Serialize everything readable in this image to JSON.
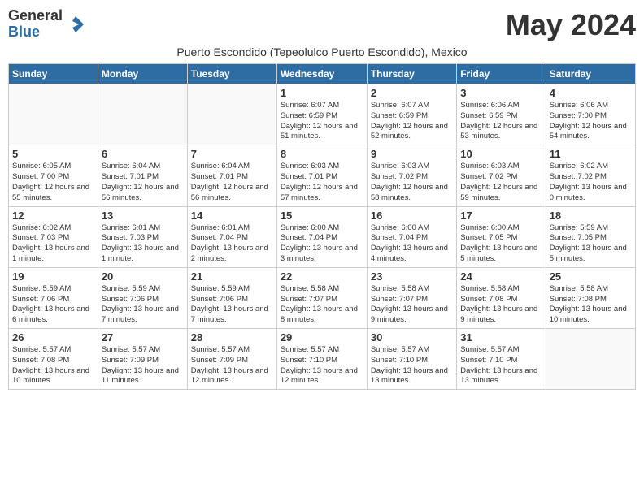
{
  "logo": {
    "general": "General",
    "blue": "Blue"
  },
  "title": "May 2024",
  "subtitle": "Puerto Escondido (Tepeolulco Puerto Escondido), Mexico",
  "weekdays": [
    "Sunday",
    "Monday",
    "Tuesday",
    "Wednesday",
    "Thursday",
    "Friday",
    "Saturday"
  ],
  "weeks": [
    [
      {
        "day": "",
        "info": ""
      },
      {
        "day": "",
        "info": ""
      },
      {
        "day": "",
        "info": ""
      },
      {
        "day": "1",
        "info": "Sunrise: 6:07 AM\nSunset: 6:59 PM\nDaylight: 12 hours and 51 minutes."
      },
      {
        "day": "2",
        "info": "Sunrise: 6:07 AM\nSunset: 6:59 PM\nDaylight: 12 hours and 52 minutes."
      },
      {
        "day": "3",
        "info": "Sunrise: 6:06 AM\nSunset: 6:59 PM\nDaylight: 12 hours and 53 minutes."
      },
      {
        "day": "4",
        "info": "Sunrise: 6:06 AM\nSunset: 7:00 PM\nDaylight: 12 hours and 54 minutes."
      }
    ],
    [
      {
        "day": "5",
        "info": "Sunrise: 6:05 AM\nSunset: 7:00 PM\nDaylight: 12 hours and 55 minutes."
      },
      {
        "day": "6",
        "info": "Sunrise: 6:04 AM\nSunset: 7:01 PM\nDaylight: 12 hours and 56 minutes."
      },
      {
        "day": "7",
        "info": "Sunrise: 6:04 AM\nSunset: 7:01 PM\nDaylight: 12 hours and 56 minutes."
      },
      {
        "day": "8",
        "info": "Sunrise: 6:03 AM\nSunset: 7:01 PM\nDaylight: 12 hours and 57 minutes."
      },
      {
        "day": "9",
        "info": "Sunrise: 6:03 AM\nSunset: 7:02 PM\nDaylight: 12 hours and 58 minutes."
      },
      {
        "day": "10",
        "info": "Sunrise: 6:03 AM\nSunset: 7:02 PM\nDaylight: 12 hours and 59 minutes."
      },
      {
        "day": "11",
        "info": "Sunrise: 6:02 AM\nSunset: 7:02 PM\nDaylight: 13 hours and 0 minutes."
      }
    ],
    [
      {
        "day": "12",
        "info": "Sunrise: 6:02 AM\nSunset: 7:03 PM\nDaylight: 13 hours and 1 minute."
      },
      {
        "day": "13",
        "info": "Sunrise: 6:01 AM\nSunset: 7:03 PM\nDaylight: 13 hours and 1 minute."
      },
      {
        "day": "14",
        "info": "Sunrise: 6:01 AM\nSunset: 7:04 PM\nDaylight: 13 hours and 2 minutes."
      },
      {
        "day": "15",
        "info": "Sunrise: 6:00 AM\nSunset: 7:04 PM\nDaylight: 13 hours and 3 minutes."
      },
      {
        "day": "16",
        "info": "Sunrise: 6:00 AM\nSunset: 7:04 PM\nDaylight: 13 hours and 4 minutes."
      },
      {
        "day": "17",
        "info": "Sunrise: 6:00 AM\nSunset: 7:05 PM\nDaylight: 13 hours and 5 minutes."
      },
      {
        "day": "18",
        "info": "Sunrise: 5:59 AM\nSunset: 7:05 PM\nDaylight: 13 hours and 5 minutes."
      }
    ],
    [
      {
        "day": "19",
        "info": "Sunrise: 5:59 AM\nSunset: 7:06 PM\nDaylight: 13 hours and 6 minutes."
      },
      {
        "day": "20",
        "info": "Sunrise: 5:59 AM\nSunset: 7:06 PM\nDaylight: 13 hours and 7 minutes."
      },
      {
        "day": "21",
        "info": "Sunrise: 5:59 AM\nSunset: 7:06 PM\nDaylight: 13 hours and 7 minutes."
      },
      {
        "day": "22",
        "info": "Sunrise: 5:58 AM\nSunset: 7:07 PM\nDaylight: 13 hours and 8 minutes."
      },
      {
        "day": "23",
        "info": "Sunrise: 5:58 AM\nSunset: 7:07 PM\nDaylight: 13 hours and 9 minutes."
      },
      {
        "day": "24",
        "info": "Sunrise: 5:58 AM\nSunset: 7:08 PM\nDaylight: 13 hours and 9 minutes."
      },
      {
        "day": "25",
        "info": "Sunrise: 5:58 AM\nSunset: 7:08 PM\nDaylight: 13 hours and 10 minutes."
      }
    ],
    [
      {
        "day": "26",
        "info": "Sunrise: 5:57 AM\nSunset: 7:08 PM\nDaylight: 13 hours and 10 minutes."
      },
      {
        "day": "27",
        "info": "Sunrise: 5:57 AM\nSunset: 7:09 PM\nDaylight: 13 hours and 11 minutes."
      },
      {
        "day": "28",
        "info": "Sunrise: 5:57 AM\nSunset: 7:09 PM\nDaylight: 13 hours and 12 minutes."
      },
      {
        "day": "29",
        "info": "Sunrise: 5:57 AM\nSunset: 7:10 PM\nDaylight: 13 hours and 12 minutes."
      },
      {
        "day": "30",
        "info": "Sunrise: 5:57 AM\nSunset: 7:10 PM\nDaylight: 13 hours and 13 minutes."
      },
      {
        "day": "31",
        "info": "Sunrise: 5:57 AM\nSunset: 7:10 PM\nDaylight: 13 hours and 13 minutes."
      },
      {
        "day": "",
        "info": ""
      }
    ]
  ]
}
